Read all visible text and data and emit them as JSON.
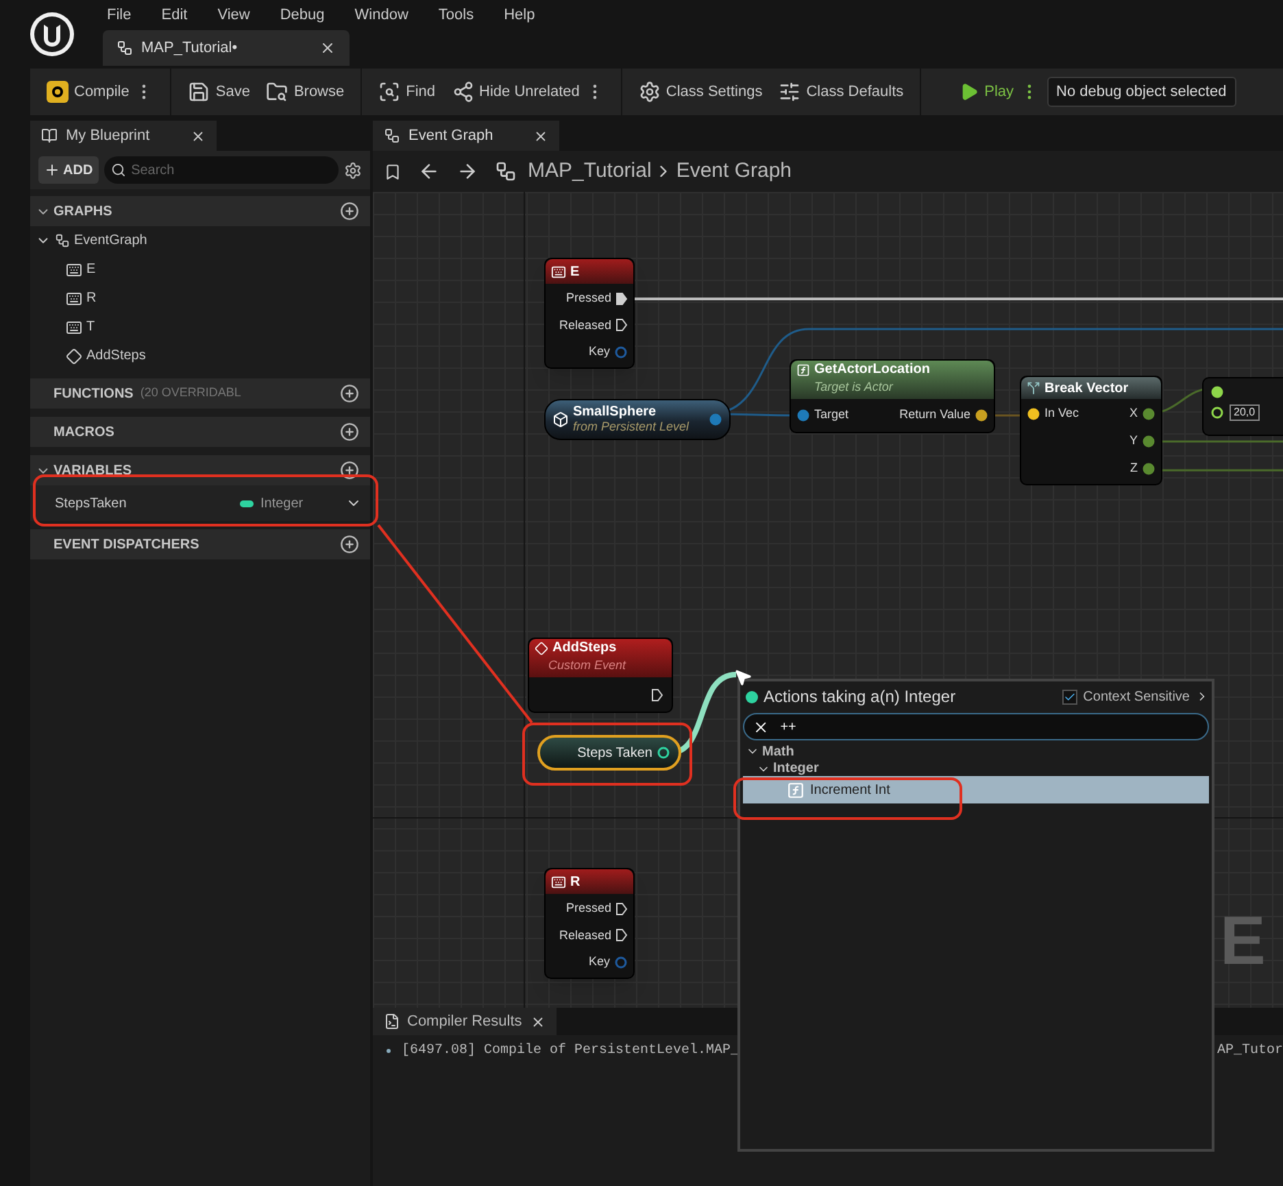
{
  "menu": [
    "File",
    "Edit",
    "View",
    "Debug",
    "Window",
    "Tools",
    "Help"
  ],
  "document_tab": {
    "label": "MAP_Tutorial•"
  },
  "toolbar": {
    "groups": [
      [
        {
          "label": "Compile",
          "menu": true
        }
      ],
      [
        {
          "label": "Save",
          "menu": false
        },
        {
          "label": "Browse",
          "menu": false
        }
      ],
      [
        {
          "label": "Find",
          "menu": false
        },
        {
          "label": "Hide Unrelated",
          "menu": true
        }
      ],
      [
        {
          "label": "Class Settings",
          "menu": false
        },
        {
          "label": "Class Defaults",
          "menu": false
        }
      ]
    ],
    "play": {
      "label": "Play",
      "menu": true
    },
    "debug_object": "No debug object selected"
  },
  "my_blueprint": {
    "tab": "My Blueprint",
    "add": "ADD",
    "search_placeholder": "Search",
    "sections": [
      {
        "title": "GRAPHS",
        "expanded": true,
        "items": [
          {
            "label": "EventGraph",
            "expanded": true,
            "children": [
              {
                "label": "E",
                "kind": "input"
              },
              {
                "label": "R",
                "kind": "input"
              },
              {
                "label": "T",
                "kind": "input"
              },
              {
                "label": "AddSteps",
                "kind": "event"
              }
            ]
          }
        ]
      },
      {
        "title": "FUNCTIONS",
        "note": "(20 OVERRIDABL",
        "expanded": false
      },
      {
        "title": "MACROS",
        "expanded": false
      },
      {
        "title": "VARIABLES",
        "expanded": true,
        "variables": [
          {
            "name": "StepsTaken",
            "type": "Integer",
            "color": "#2ed3a0",
            "annotated": true
          }
        ]
      },
      {
        "title": "EVENT DISPATCHERS",
        "expanded": false
      }
    ]
  },
  "graph_tab": {
    "label": "Event Graph"
  },
  "breadcrumb": [
    "MAP_Tutorial",
    "Event Graph"
  ],
  "nodes": [
    {
      "kind": "input_event",
      "title": "E",
      "pins": [
        {
          "label": "Pressed",
          "kind": "exec",
          "connected": true
        },
        {
          "label": "Released",
          "kind": "exec",
          "connected": false
        },
        {
          "label": "Key",
          "kind": "data",
          "connected": false
        }
      ]
    },
    {
      "kind": "actor_ref",
      "title": "SmallSphere",
      "subtitle": "from Persistent Level"
    },
    {
      "kind": "function",
      "title": "GetActorLocation",
      "subtitle": "Target is Actor",
      "input": "Target",
      "output": "Return Value"
    },
    {
      "kind": "break",
      "title": "Break Vector",
      "input": "In Vec",
      "outputs": [
        "X",
        "Y",
        "Z"
      ]
    },
    {
      "kind": "partial",
      "value": "20,0"
    },
    {
      "kind": "custom_event",
      "title": "AddSteps",
      "subtitle": "Custom Event"
    },
    {
      "kind": "variable_get",
      "title": "Steps Taken",
      "annotated": true
    },
    {
      "kind": "input_event",
      "title": "R",
      "pins": [
        {
          "label": "Pressed",
          "kind": "exec",
          "connected": false
        },
        {
          "label": "Released",
          "kind": "exec",
          "connected": false
        },
        {
          "label": "Key",
          "kind": "data",
          "connected": false
        }
      ]
    }
  ],
  "graph_watermark": "E",
  "compiler_results": {
    "tab": "Compiler Results",
    "line_start": "[6497.08] Compile of PersistentLevel.MAP_",
    "line_end": "AP_Tutor"
  },
  "action_menu": {
    "title": "Actions taking a(n) Integer",
    "context_sensitive": {
      "label": "Context Sensitive",
      "checked": true
    },
    "search_value": "++",
    "tree": [
      {
        "label": "Math",
        "expanded": true,
        "children": [
          {
            "label": "Integer",
            "expanded": true,
            "children": [
              {
                "label": "Increment Int",
                "selected": true,
                "annotated": true
              }
            ]
          }
        ]
      }
    ]
  }
}
